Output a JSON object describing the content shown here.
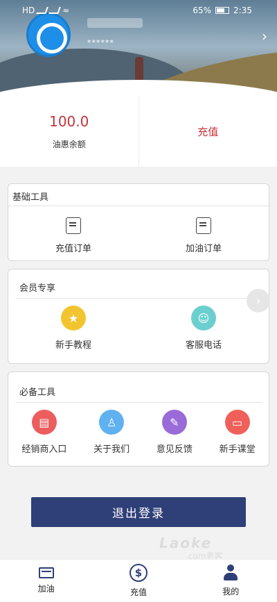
{
  "status_bar": {
    "time": "2:35",
    "battery": "65%",
    "carrier": "HD"
  },
  "header": {
    "username_masked": "******"
  },
  "balance": {
    "value": "100.0",
    "label": "油惠余额",
    "recharge_label": "充值"
  },
  "basic_tools": {
    "title": "基础工具",
    "items": [
      {
        "label": "充值订单",
        "icon": "recharge-order-icon"
      },
      {
        "label": "加油订单",
        "icon": "fuel-order-icon"
      }
    ]
  },
  "member": {
    "title": "会员专享",
    "items": [
      {
        "label": "新手教程",
        "icon": "tutorial-icon",
        "color": "#f2c530"
      },
      {
        "label": "客服电话",
        "icon": "customer-service-icon",
        "color": "#6ccfcf"
      }
    ]
  },
  "essential_tools": {
    "title": "必备工具",
    "items": [
      {
        "label": "经销商入口",
        "icon": "dealer-icon",
        "color": "#ec5d5d"
      },
      {
        "label": "关于我们",
        "icon": "about-icon",
        "color": "#5fb1f0"
      },
      {
        "label": "意见反馈",
        "icon": "feedback-icon",
        "color": "#9a6ad8"
      },
      {
        "label": "新手课堂",
        "icon": "classroom-icon",
        "color": "#f0605a"
      }
    ]
  },
  "logout_label": "退出登录",
  "watermark": {
    "main": "Laoke",
    "sub": ".com老客"
  },
  "nav": {
    "items": [
      {
        "label": "加油",
        "icon": "card-icon"
      },
      {
        "label": "充值",
        "icon": "dollar-icon"
      },
      {
        "label": "我的",
        "icon": "person-icon"
      }
    ]
  },
  "colors": {
    "accent": "#2f3f78",
    "price_red": "#c8323a"
  }
}
